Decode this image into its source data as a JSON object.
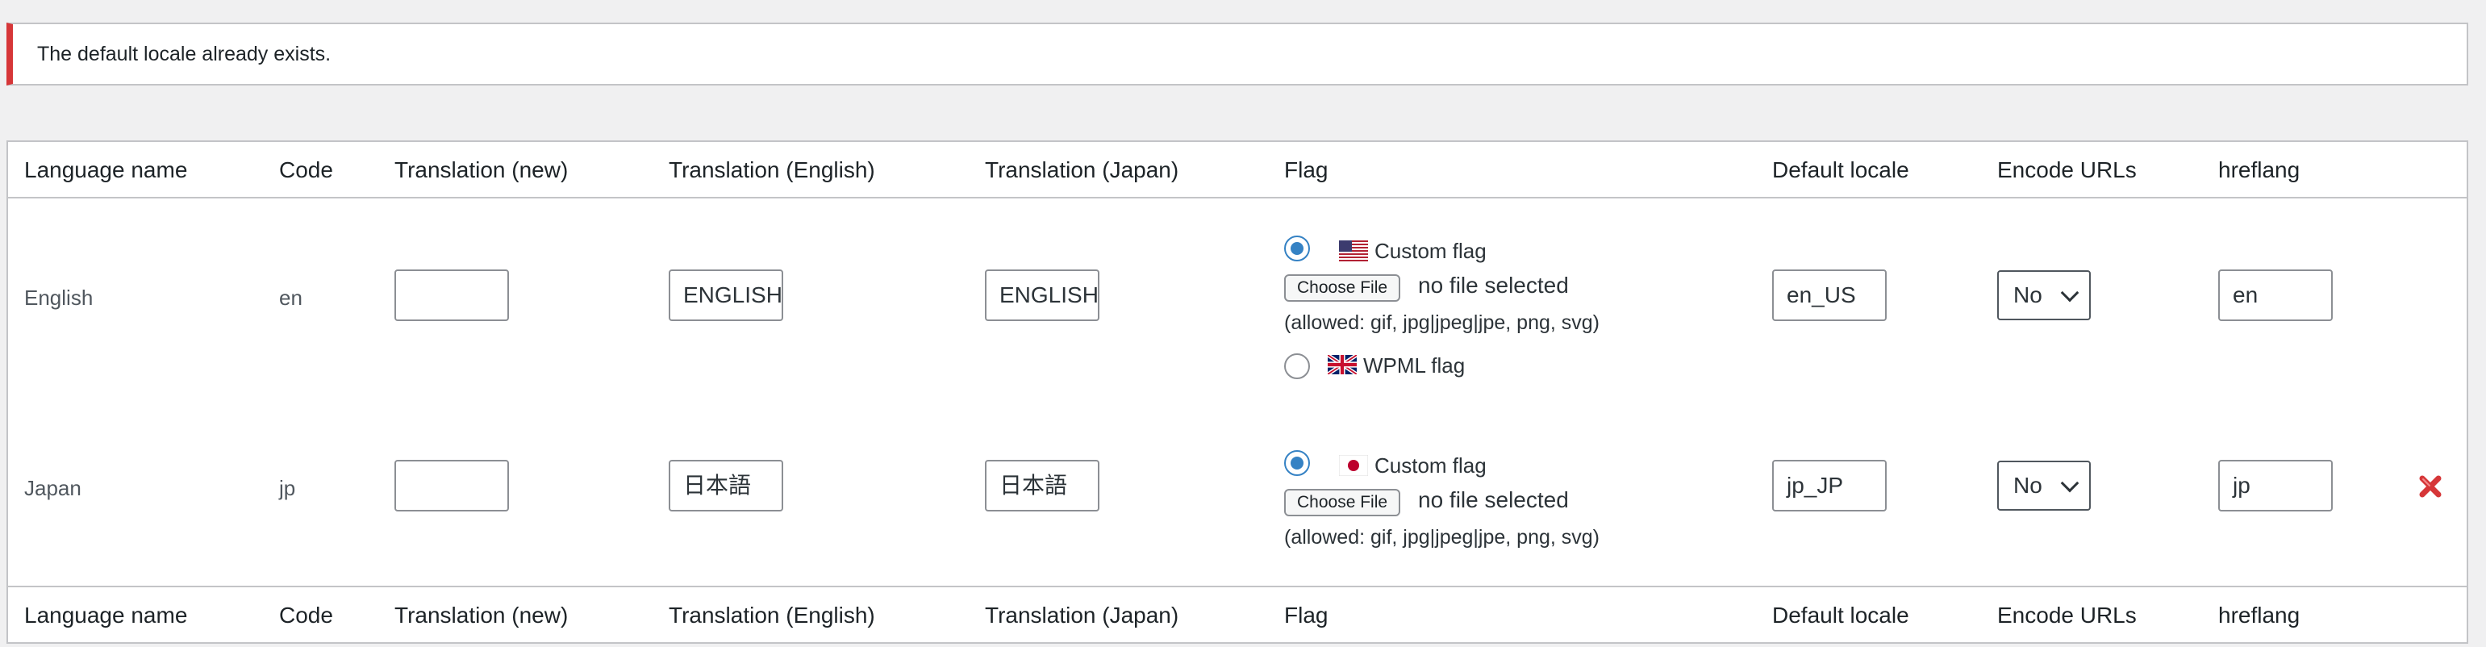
{
  "notice": {
    "message": "The default locale already exists."
  },
  "columns": {
    "language_name": "Language name",
    "code": "Code",
    "translation_new": "Translation (new)",
    "translation_english": "Translation (English)",
    "translation_japan": "Translation (Japan)",
    "flag": "Flag",
    "default_locale": "Default locale",
    "encode_urls": "Encode URLs",
    "hreflang": "hreflang"
  },
  "rows": [
    {
      "language_name": "English",
      "code": "en",
      "translation_new": "",
      "translation_english": "ENGLISH",
      "translation_japan": "ENGLISH",
      "custom_flag_label": "Custom flag",
      "custom_flag_icon": "us-flag-icon",
      "choose_file_label": "Choose File",
      "file_status": "no file selected",
      "allowed_types": "(allowed: gif, jpg|jpeg|jpe, png, svg)",
      "wpml_flag_label": "WPML flag",
      "wpml_flag_icon": "uk-flag-icon",
      "default_locale": "en_US",
      "encode_urls": "No",
      "hreflang": "en"
    },
    {
      "language_name": "Japan",
      "code": "jp",
      "translation_new": "",
      "translation_english": "日本語",
      "translation_japan": "日本語",
      "custom_flag_label": "Custom flag",
      "custom_flag_icon": "japan-flag-icon",
      "choose_file_label": "Choose File",
      "file_status": "no file selected",
      "allowed_types": "(allowed: gif, jpg|jpeg|jpe, png, svg)",
      "default_locale": "jp_JP",
      "encode_urls": "No",
      "hreflang": "jp",
      "delete_icon": "delete-icon"
    }
  ],
  "colors": {
    "notice_error": "#d63638",
    "radio_checked": "#3582c4",
    "delete_red": "#d63638",
    "border": "#c3c4c7"
  }
}
